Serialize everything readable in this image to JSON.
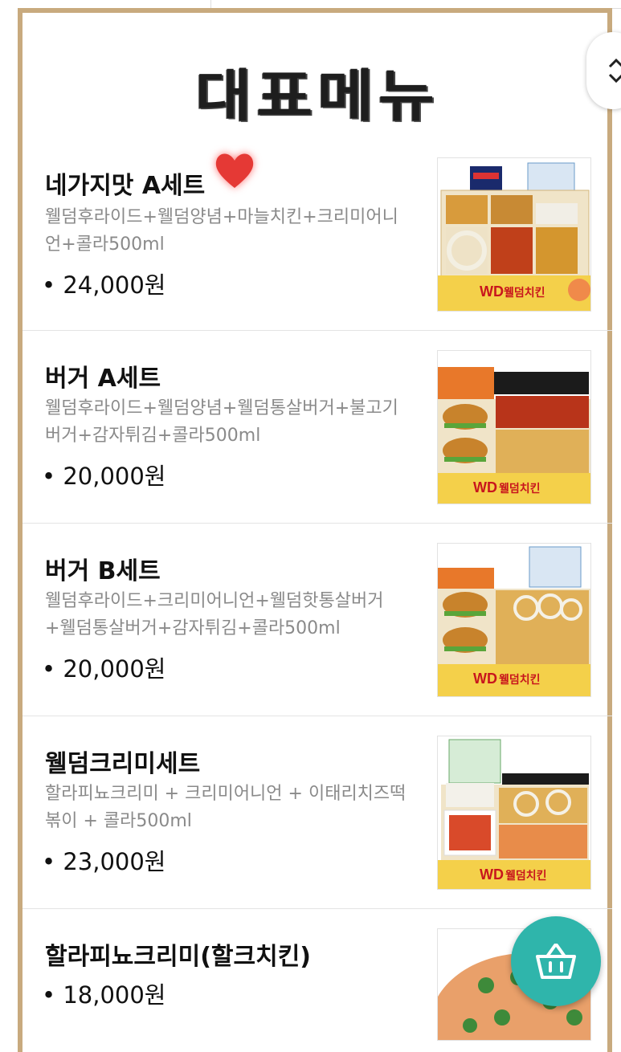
{
  "page": {
    "title": "대표메뉴",
    "accent_color": "#c8aa7e",
    "cart_color": "#2fb5ab"
  },
  "icons": {
    "scroll": "chevron-up-down-icon",
    "cart": "shopping-basket-icon",
    "heart": "heart-icon"
  },
  "menu": {
    "items": [
      {
        "name": "네가지맛 A세트",
        "desc": "웰덤후라이드+웰덤양념+마늘치킨+크리미어니언+콜라500ml",
        "price": "• 24,000원",
        "logo": "웰덤치킨",
        "logo_mark": "WD"
      },
      {
        "name": "버거 A세트",
        "desc": "웰덤후라이드+웰덤양념+웰덤통살버거+불고기버거+감자튀김+콜라500ml",
        "price": "• 20,000원",
        "logo": "웰덤치킨",
        "logo_mark": "WD"
      },
      {
        "name": "버거 B세트",
        "desc": "웰덤후라이드+크리미어니언+웰덤핫통살버거+웰덤통살버거+감자튀김+콜라500ml",
        "price": "• 20,000원",
        "logo": "웰덤치킨",
        "logo_mark": "WD"
      },
      {
        "name": "웰덤크리미세트",
        "desc": "할라피뇨크리미 + 크리미어니언 + 이태리치즈떡볶이 + 콜라500ml",
        "price": "• 23,000원",
        "logo": "웰덤치킨",
        "logo_mark": "WD"
      },
      {
        "name": "할라피뇨크리미(할크치킨)",
        "desc": "",
        "price": "• 18,000원"
      }
    ]
  }
}
